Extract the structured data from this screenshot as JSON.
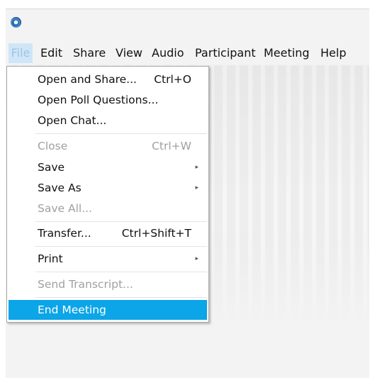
{
  "menubar": {
    "items": [
      {
        "label": "File"
      },
      {
        "label": "Edit"
      },
      {
        "label": "Share"
      },
      {
        "label": "View"
      },
      {
        "label": "Audio"
      },
      {
        "label": "Participant"
      },
      {
        "label": "Meeting"
      },
      {
        "label": "Help"
      }
    ]
  },
  "file_menu": {
    "items": [
      {
        "label": "Open and Share...",
        "shortcut": "Ctrl+O"
      },
      {
        "label": "Open Poll Questions..."
      },
      {
        "label": "Open Chat..."
      },
      {
        "label": "Close",
        "shortcut": "Ctrl+W",
        "disabled": true
      },
      {
        "label": "Save"
      },
      {
        "label": "Save As"
      },
      {
        "label": "Save All...",
        "disabled": true
      },
      {
        "label": "Transfer...",
        "shortcut": "Ctrl+Shift+T"
      },
      {
        "label": "Print"
      },
      {
        "label": "Send Transcript...",
        "disabled": true
      },
      {
        "label": "End Meeting",
        "highlighted": true
      }
    ],
    "submenu_arrow": "▸"
  },
  "colors": {
    "highlight": "#0ba5e8",
    "active_menu_bg": "#cfe6f8",
    "disabled_text": "#a0a0a0"
  }
}
